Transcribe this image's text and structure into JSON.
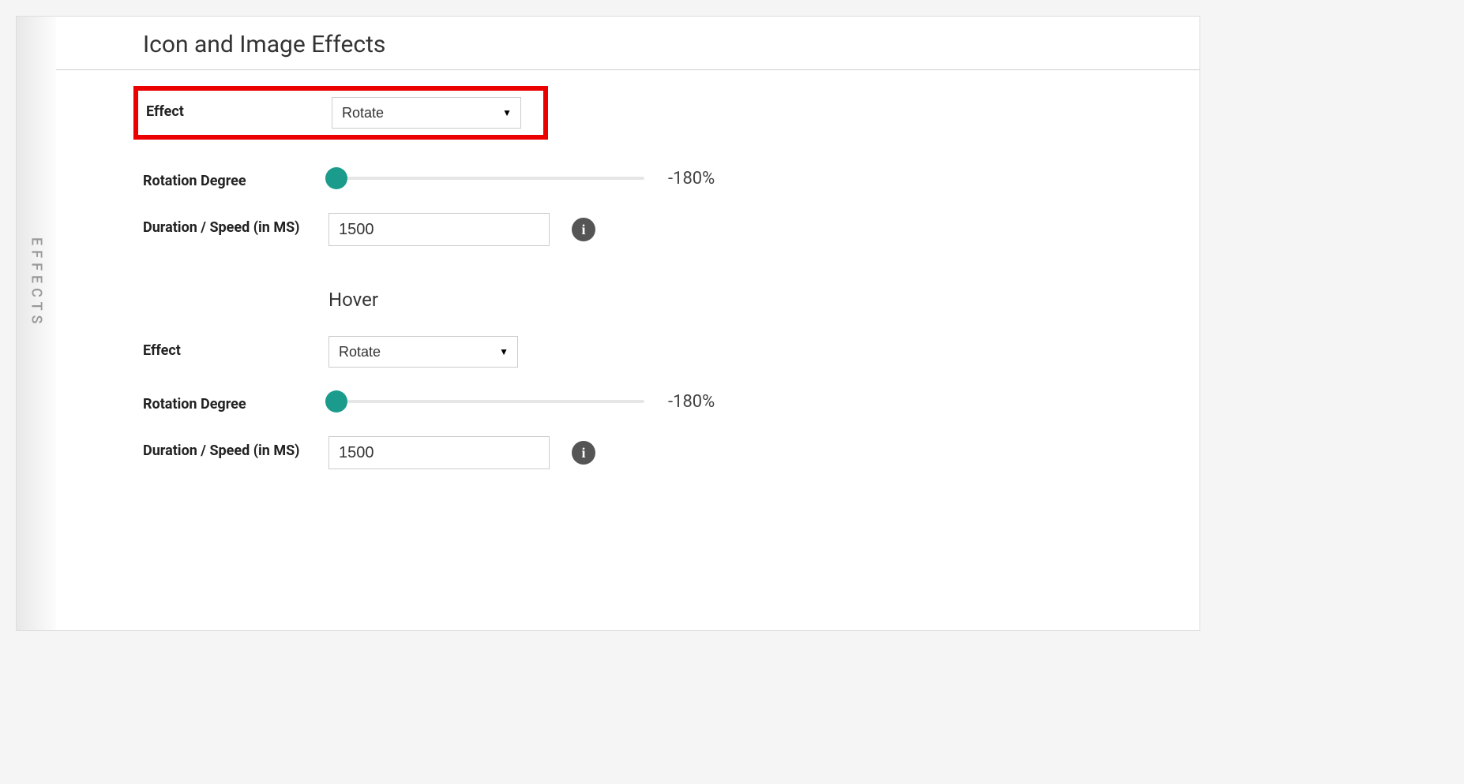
{
  "sidebar": {
    "tab_label": "EFFECTS"
  },
  "section": {
    "title": "Icon and Image Effects"
  },
  "normal": {
    "effect_label": "Effect",
    "effect_value": "Rotate",
    "rotation_label": "Rotation Degree",
    "rotation_value": "-180%",
    "duration_label": "Duration / Speed (in MS)",
    "duration_value": "1500"
  },
  "hover": {
    "heading": "Hover",
    "effect_label": "Effect",
    "effect_value": "Rotate",
    "rotation_label": "Rotation Degree",
    "rotation_value": "-180%",
    "duration_label": "Duration / Speed (in MS)",
    "duration_value": "1500"
  },
  "icons": {
    "info_glyph": "i"
  }
}
